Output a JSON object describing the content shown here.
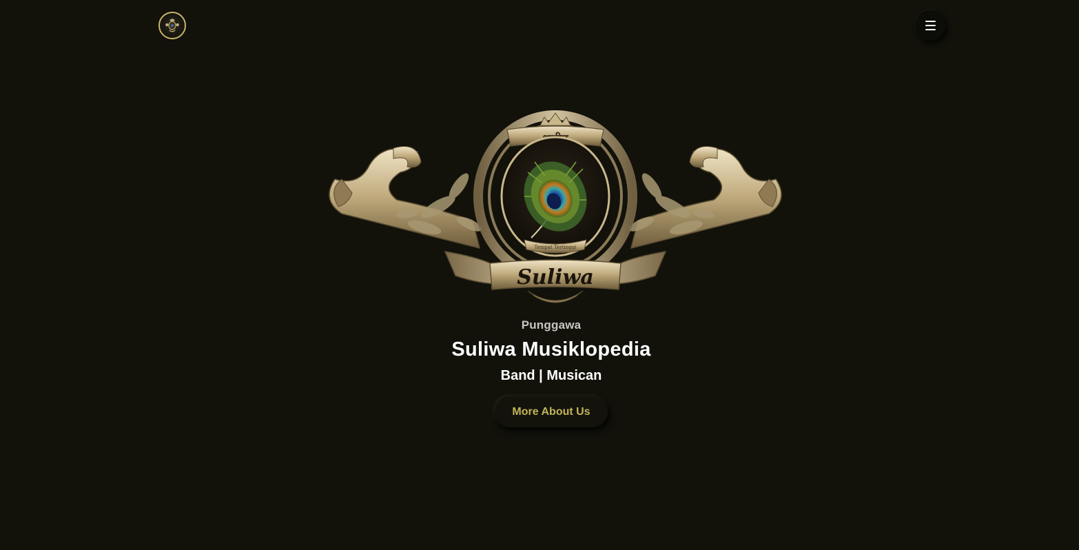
{
  "header": {
    "logo_icon": "crest-logo-icon",
    "menu_icon": "hamburger-icon"
  },
  "crest": {
    "banner_text": "Suliwa",
    "top_script": "शूलीद्व",
    "ribbon_text": "Tempat Tertinggi"
  },
  "hero": {
    "overline": "Punggawa",
    "title": "Suliwa Musiklopedia",
    "subtitle": "Band | Musican",
    "cta_label": "More About Us"
  },
  "colors": {
    "background": "#12120b",
    "accent": "#c2b35a",
    "gold": "#c9b56a",
    "text": "#ffffff"
  }
}
